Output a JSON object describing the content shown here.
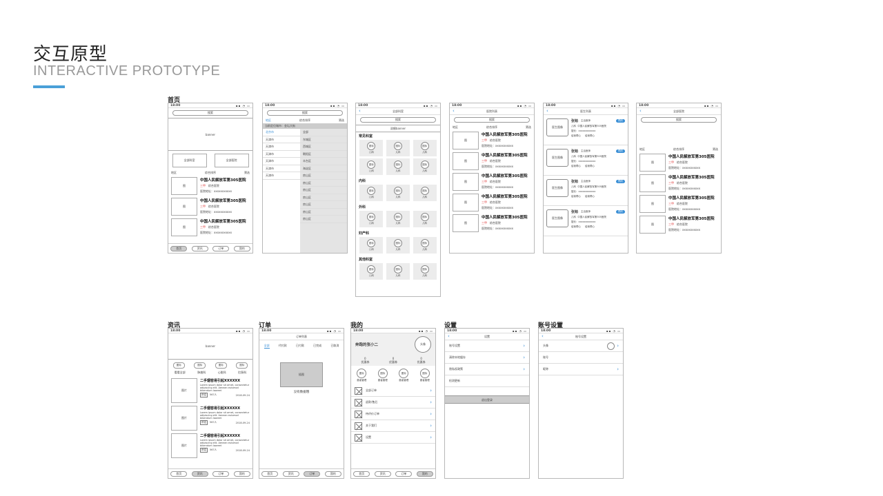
{
  "header": {
    "title": "交互原型",
    "subtitle": "INTERACTIVE PROTOTYPE"
  },
  "sections": {
    "home": "首页",
    "news": "资讯",
    "orders": "订单",
    "me": "我的",
    "settings": "设置",
    "account": "账号设置"
  },
  "status": {
    "time": "18:00"
  },
  "common": {
    "search": "搜索",
    "banner": "banner",
    "region": "地区",
    "sort": "综合排序",
    "filter": "筛选",
    "hospital_name": "中国人民解放军第305医院",
    "grade": "三甲",
    "type": "综合医院",
    "address": "医院地址：xxxxxxxxxxx",
    "img": "图",
    "tab_home": "首页",
    "tab_news": "资讯",
    "tab_orders": "订单",
    "tab_me": "我的"
  },
  "home": {
    "all_dept": "全部科室",
    "all_hosp": "全部医院"
  },
  "city": {
    "tab_area": "地区",
    "tab_sort": "综合排序",
    "tab_filter": "筛选",
    "current": "当前定位城市：金坛大街",
    "cities": [
      "北京市",
      "天津市",
      "天津市",
      "天津市",
      "天津市",
      "天津市",
      "天津市"
    ],
    "districts": [
      "全部",
      "东城区",
      "西城区",
      "朝阳区",
      "丰台区",
      "海淀区",
      "房山区",
      "房山区",
      "房山区",
      "房山区",
      "房山区",
      "房山区",
      "房山区"
    ]
  },
  "dept": {
    "title": "全部科室",
    "banner": "双模banner",
    "icon": "图标",
    "label": "儿科",
    "groups": [
      "常见科室",
      "内科",
      "外科",
      "妇产科",
      "其他科室"
    ]
  },
  "hosplist": {
    "title": "医院列表"
  },
  "doclist": {
    "title": "医生列表",
    "photo": "医生图像",
    "name": "张勉",
    "role": "主治医师",
    "pill": "预约",
    "dept": "儿科",
    "hosp": "中国人民解放军第305医院",
    "skill": "擅长：xxxxxxxxxxxx",
    "tag1": "给我帮心",
    "tag2": "给我帮心"
  },
  "search": {
    "title": "全部医院"
  },
  "news": {
    "chips": [
      "图标",
      "图标",
      "图标",
      "图标"
    ],
    "cats": [
      "看看全部",
      "肺癌科",
      "心脏科",
      "肛肠科"
    ],
    "img": "图片",
    "title": "二手烟容易引起XXXXXX",
    "body": "Lorem ipsum dolor sit amet, consectetur adipiscing elit. Aenean euismod bibendum laoreet",
    "tag": "肝癌",
    "views": "567人",
    "date": "2018-09-24"
  },
  "orders": {
    "title": "订单列表",
    "tabs": [
      "全部",
      "代付款",
      "已付款",
      "已完成",
      "已取消"
    ],
    "empty_img": "插图",
    "empty_text": "没有数据哦"
  },
  "me": {
    "name": "奔跑的张小二",
    "avatar": "头像",
    "stats": [
      {
        "v": "0",
        "l": "优惠券"
      },
      {
        "v": "0",
        "l": "优惠券"
      },
      {
        "v": "0",
        "l": "优惠券"
      }
    ],
    "icon": "图标",
    "mgr": "患者管理",
    "menu": [
      "全部订单",
      "退款/售后",
      "待评价订单",
      "关于我们",
      "设置"
    ]
  },
  "settings": {
    "title": "设置",
    "items": [
      "账号设置",
      "清除本地缓存",
      "隐私权政策",
      "检测更新"
    ],
    "logout": "退出登录"
  },
  "account": {
    "title": "账号设置",
    "items": [
      "头像",
      "账号",
      "昵称"
    ]
  }
}
